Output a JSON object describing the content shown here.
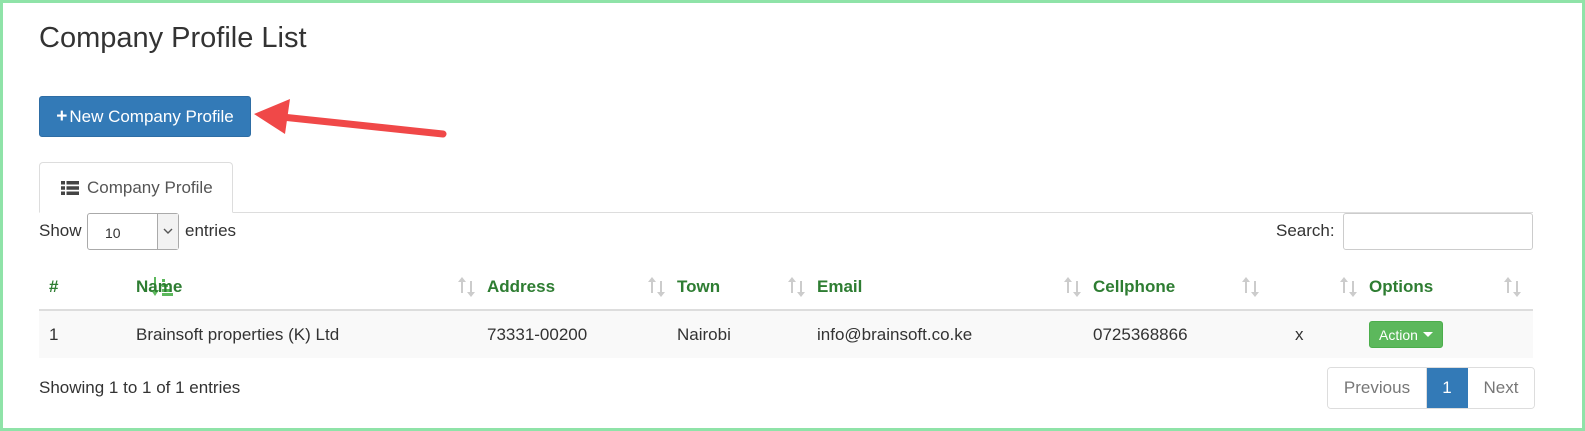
{
  "page": {
    "title": "Company Profile List"
  },
  "toolbar": {
    "new_button_label": "New Company Profile",
    "new_button_icon": "plus-icon"
  },
  "tabs": [
    {
      "label": "Company Profile",
      "icon": "list-icon"
    }
  ],
  "length_menu": {
    "show_label": "Show",
    "selected": "10",
    "entries_label": "entries"
  },
  "search": {
    "label": "Search:",
    "value": ""
  },
  "table": {
    "columns": [
      "#",
      "",
      "Name",
      "Address",
      "Town",
      "Email",
      "Cellphone",
      "",
      "Options"
    ],
    "rows": [
      {
        "num": "1",
        "name": "Brainsoft properties (K) Ltd",
        "address": "73331-00200",
        "town": "Nairobi",
        "email": "info@brainsoft.co.ke",
        "cellphone": "0725368866",
        "extra": "x",
        "action_label": "Action"
      }
    ]
  },
  "footer": {
    "info": "Showing 1 to 1 of 1 entries",
    "pagination": {
      "previous": "Previous",
      "current": "1",
      "next": "Next"
    }
  },
  "colors": {
    "primary": "#337ab7",
    "success": "#5cb85c",
    "header_text": "#2e7d32",
    "annotation_arrow": "#f04848",
    "frame_border": "#8fe3a8"
  }
}
